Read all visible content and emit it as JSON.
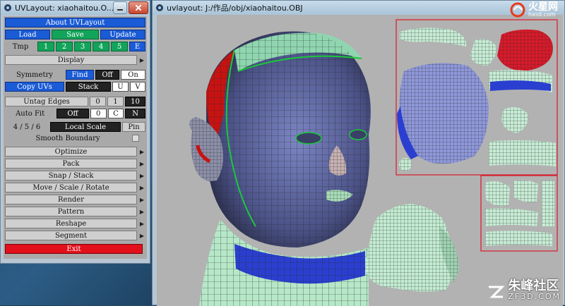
{
  "panel": {
    "title": "UVLayout: xiaohaitou.O...",
    "about": "About UVLayout",
    "load": "Load",
    "save": "Save",
    "update": "Update",
    "tmp": "Tmp",
    "tmp_slots": [
      "1",
      "2",
      "3",
      "4",
      "5"
    ],
    "e": "E",
    "display": "Display",
    "symmetry": "Symmetry",
    "find": "Find",
    "off": "Off",
    "on": "On",
    "copy_uvs": "Copy UVs",
    "stack": "Stack",
    "u": "U",
    "v": "V",
    "untag_edges": "Untag Edges",
    "zero": "0",
    "one": "1",
    "ten": "10",
    "auto_fit": "Auto Fit",
    "autofit_off": "Off",
    "autofit_0": "0",
    "autofit_c": "C",
    "autofit_n": "N",
    "steps": "4 / 5 / 6",
    "local_scale": "Local Scale",
    "pin": "Pin",
    "smooth_boundary": "Smooth Boundary",
    "menus": [
      "Optimize",
      "Pack",
      "Snap / Stack",
      "Move / Scale / Rotate",
      "Render",
      "Pattern",
      "Reshape",
      "Segment"
    ],
    "exit": "Exit"
  },
  "main": {
    "title": "uvlayout: J:/作品/obj/xiaohaitou.OBJ"
  },
  "watermark_top": {
    "brand": "火星网",
    "url": "hxsd.com"
  },
  "watermark_bottom": {
    "brand": "朱峰社区",
    "url": "ZF3D.COM"
  },
  "colors": {
    "blue": "#1a5bd6",
    "green": "#12a45a",
    "red": "#e2101a"
  }
}
